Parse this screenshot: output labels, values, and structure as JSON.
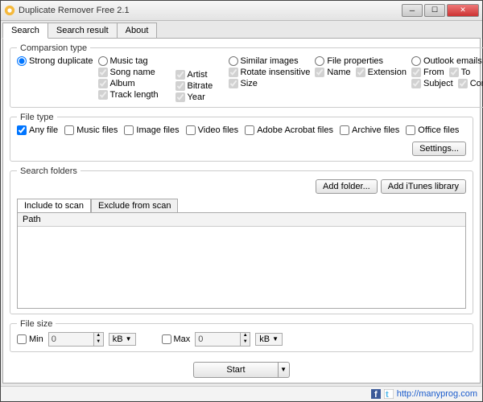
{
  "window_title": "Duplicate Remover Free 2.1",
  "tabs": [
    "Search",
    "Search result",
    "About"
  ],
  "comparison": {
    "legend": "Comparsion type",
    "strong": "Strong duplicate",
    "music": {
      "label": "Music tag",
      "opts": [
        "Song name",
        "Artist",
        "Album",
        "Bitrate",
        "Track length",
        "Year"
      ]
    },
    "images": {
      "label": "Similar images",
      "opts": [
        "Rotate insensitive",
        "Size"
      ]
    },
    "props": {
      "label": "File properties",
      "opts": [
        "Name",
        "Extension"
      ]
    },
    "outlook": {
      "label": "Outlook emails",
      "opts": [
        "From",
        "To",
        "Subject",
        "Content"
      ]
    }
  },
  "filetype": {
    "legend": "File type",
    "opts": [
      "Any file",
      "Music files",
      "Image files",
      "Video files",
      "Adobe Acrobat files",
      "Archive files",
      "Office files"
    ],
    "settings": "Settings..."
  },
  "folders": {
    "legend": "Search folders",
    "add_folder": "Add folder...",
    "add_itunes": "Add iTunes library",
    "subtabs": [
      "Include to scan",
      "Exclude from scan"
    ],
    "path_header": "Path"
  },
  "filesize": {
    "legend": "File size",
    "min_label": "Min",
    "max_label": "Max",
    "min_val": "0",
    "max_val": "0",
    "unit": "kB"
  },
  "start": "Start",
  "footer_url": "http://manyprog.com"
}
